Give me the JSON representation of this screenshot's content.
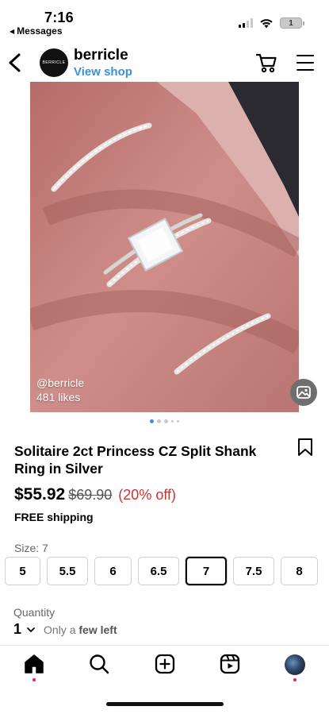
{
  "status": {
    "time": "7:16",
    "back_app": "Messages",
    "battery": "1"
  },
  "header": {
    "avatar_text": "BERRICLE",
    "shop_name": "berricle",
    "view_shop": "View shop"
  },
  "image": {
    "handle": "@berricle",
    "likes": "481 likes",
    "carousel_count": 5,
    "carousel_active": 1
  },
  "product": {
    "title": "Solitaire 2ct Princess CZ Split Shank Ring in Silver",
    "price": "$55.92",
    "original_price": "$69.90",
    "discount": "(20% off)",
    "shipping": "FREE shipping"
  },
  "size": {
    "label": "Size: 7",
    "options": [
      "5",
      "5.5",
      "6",
      "6.5",
      "7",
      "7.5",
      "8"
    ],
    "selected": "7"
  },
  "quantity": {
    "label": "Quantity",
    "value": "1",
    "note_prefix": "Only a",
    "note_bold": "few left"
  },
  "bottom_nav": {
    "items": [
      "home-icon",
      "search-icon",
      "create-icon",
      "reels-icon",
      "profile-avatar"
    ],
    "active": "home-icon"
  },
  "colors": {
    "link_blue": "#3d8fd6",
    "discount_red": "#cc3333",
    "notification_pink": "#e0245e",
    "image_pink": "#c47f7c"
  }
}
